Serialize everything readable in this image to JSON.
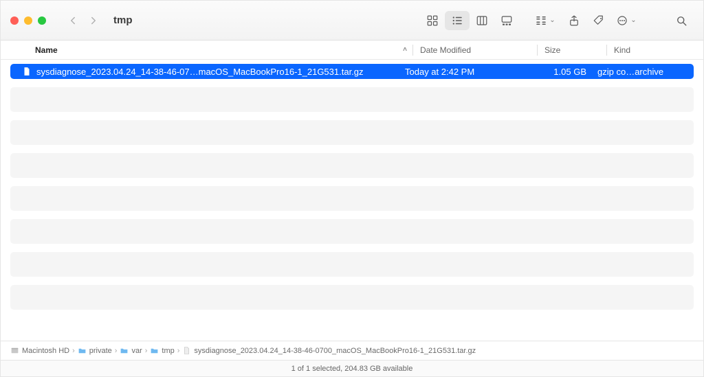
{
  "window": {
    "title": "tmp"
  },
  "columns": {
    "name": "Name",
    "date": "Date Modified",
    "size": "Size",
    "kind": "Kind"
  },
  "file": {
    "name": "sysdiagnose_2023.04.24_14-38-46-07…macOS_MacBookPro16-1_21G531.tar.gz",
    "date": "Today at 2:42 PM",
    "size": "1.05 GB",
    "kind": "gzip co…archive"
  },
  "path": {
    "root": "Macintosh HD",
    "p1": "private",
    "p2": "var",
    "p3": "tmp",
    "leaf": "sysdiagnose_2023.04.24_14-38-46-0700_macOS_MacBookPro16-1_21G531.tar.gz"
  },
  "status": "1 of 1 selected, 204.83 GB available"
}
